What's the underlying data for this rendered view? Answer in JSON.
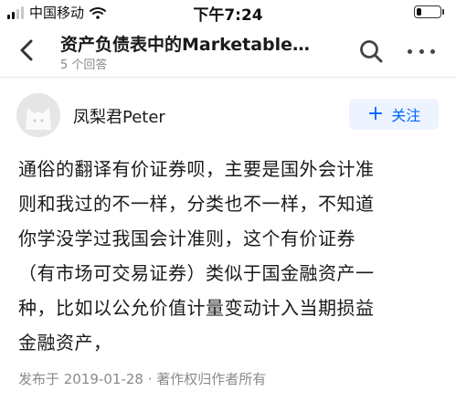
{
  "status_bar": {
    "carrier": "中国移动",
    "time": "下午7:24",
    "battery_level": 0.2
  },
  "nav": {
    "title": "资产负债表中的Marketable…",
    "subtitle": "5 个回答",
    "back_icon": "chevron-left-icon",
    "search_icon": "search-icon",
    "more_icon": "more-horizontal-icon"
  },
  "author": {
    "name": "凤梨君Peter",
    "avatar_icon": "cat-avatar",
    "follow_label": "关注"
  },
  "answer": {
    "lines": [
      "通俗的翻译有价证券呗，主要是国外会计准",
      "则和我过的不一样，分类也不一样，不知道",
      "你学没学过我国会计准则，这个有价证券",
      "（有市场可交易证券）类似于国金融资产一",
      "种，比如以公允价值计量变动计入当期损益",
      "金融资产，"
    ]
  },
  "meta": {
    "text": "发布于 2019-01-28 · 著作权归作者所有"
  },
  "colors": {
    "accent": "#0066ff",
    "follow_bg": "#eef4ff",
    "muted": "#8a8a8a"
  }
}
